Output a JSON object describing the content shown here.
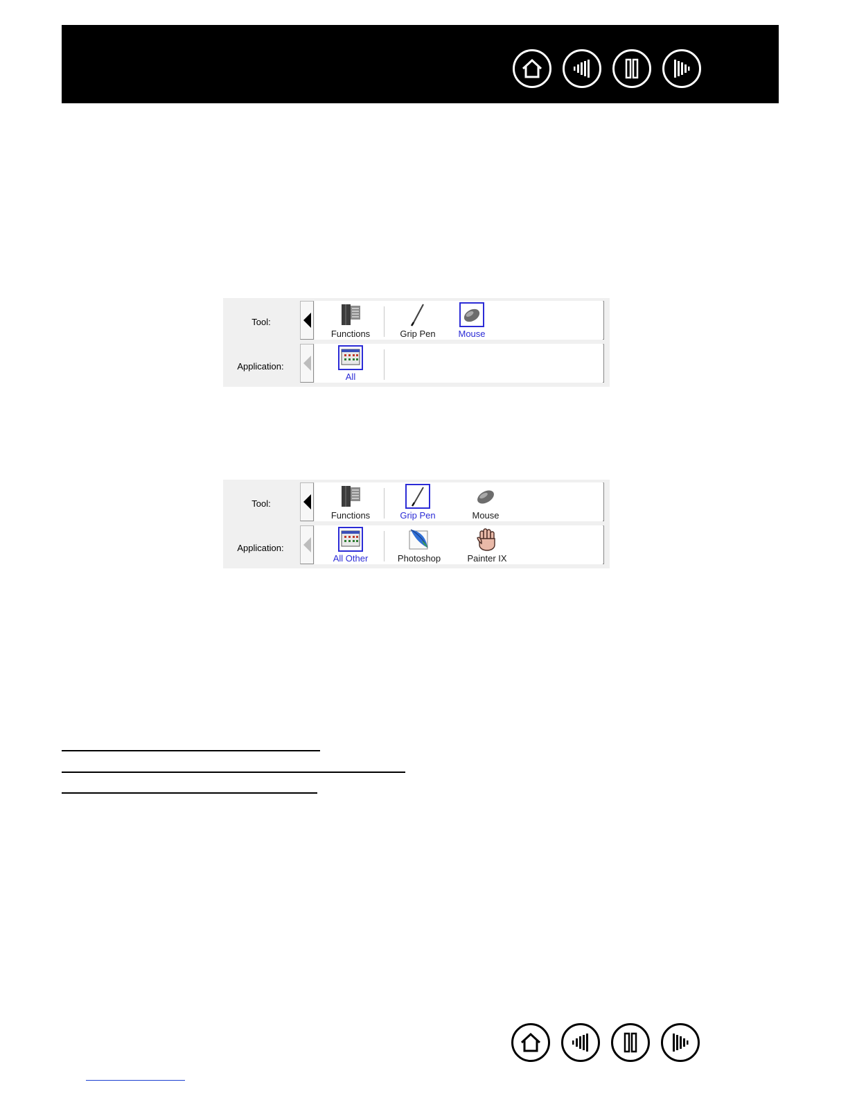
{
  "nav": {
    "buttons": [
      {
        "name": "home"
      },
      {
        "name": "contents"
      },
      {
        "name": "index"
      },
      {
        "name": "next"
      }
    ]
  },
  "panel1": {
    "tool_label": "Tool:",
    "application_label": "Application:",
    "tools": [
      {
        "label": "Functions",
        "selected": false,
        "icon": "functions-icon"
      },
      {
        "label": "Grip Pen",
        "selected": false,
        "icon": "grip-pen-icon"
      },
      {
        "label": "Mouse",
        "selected": true,
        "icon": "mouse-icon"
      }
    ],
    "applications": [
      {
        "label": "All",
        "selected": true,
        "icon": "all-apps-icon"
      }
    ]
  },
  "panel2": {
    "tool_label": "Tool:",
    "application_label": "Application:",
    "tools": [
      {
        "label": "Functions",
        "selected": false,
        "icon": "functions-icon"
      },
      {
        "label": "Grip Pen",
        "selected": true,
        "icon": "grip-pen-icon"
      },
      {
        "label": "Mouse",
        "selected": false,
        "icon": "mouse-icon"
      }
    ],
    "applications": [
      {
        "label": "All Other",
        "selected": true,
        "icon": "all-apps-icon"
      },
      {
        "label": "Photoshop",
        "selected": false,
        "icon": "photoshop-feather-icon"
      },
      {
        "label": "Painter IX",
        "selected": false,
        "icon": "painter-hand-icon"
      }
    ]
  },
  "colors": {
    "selection": "#2b2bd6",
    "header": "#000000",
    "panel_bg": "#f0f0f0"
  }
}
